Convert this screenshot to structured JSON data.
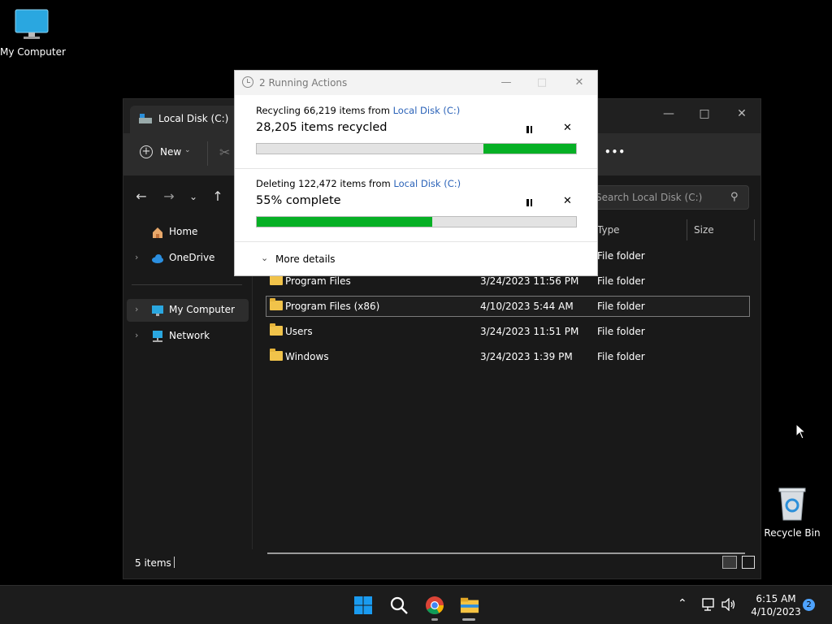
{
  "desktop": {
    "icons": [
      {
        "label": "My Computer"
      },
      {
        "label": "Recycle Bin"
      }
    ]
  },
  "explorer": {
    "tab_title": "Local Disk (C:)",
    "new_label": "New",
    "more_label": "•••",
    "search_placeholder": "Search Local Disk (C:)",
    "columns": {
      "type": "Type",
      "size": "Size"
    },
    "sidebar": [
      {
        "label": "Home"
      },
      {
        "label": "OneDrive"
      },
      {
        "label": "My Computer"
      },
      {
        "label": "Network"
      }
    ],
    "rows": [
      {
        "name": "",
        "date": "",
        "type": "File folder"
      },
      {
        "name": "Program Files",
        "date": "3/24/2023 11:56 PM",
        "type": "File folder"
      },
      {
        "name": "Program Files (x86)",
        "date": "4/10/2023 5:44 AM",
        "type": "File folder"
      },
      {
        "name": "Users",
        "date": "3/24/2023 11:51 PM",
        "type": "File folder"
      },
      {
        "name": "Windows",
        "date": "3/24/2023 1:39 PM",
        "type": "File folder"
      }
    ],
    "status": "5 items"
  },
  "dialog": {
    "title": "2 Running Actions",
    "operations": [
      {
        "line1_prefix": "Recycling 66,219 items from ",
        "link": "Local Disk (C:)",
        "line2": "28,205 items recycled",
        "progress_start": 0.71,
        "progress_end": 1.0
      },
      {
        "line1_prefix": "Deleting 122,472 items from ",
        "link": "Local Disk (C:)",
        "line2": "55% complete",
        "progress_start": 0.0,
        "progress_end": 0.55
      }
    ],
    "more_details": "More details",
    "progress_color": "#06b025"
  },
  "taskbar": {
    "time": "6:15 AM",
    "date": "4/10/2023",
    "notification_count": "2"
  }
}
